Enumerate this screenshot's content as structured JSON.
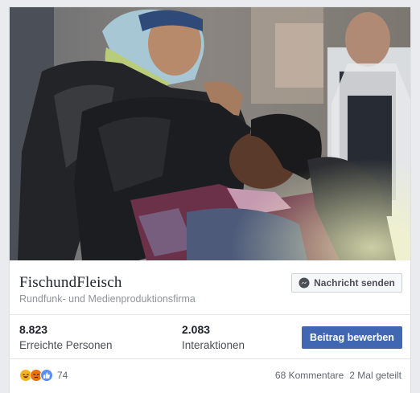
{
  "page": {
    "name": "FischundFleisch",
    "category": "Rundfunk- und Medienproduktionsfirma",
    "message_button_label": "Nachricht senden"
  },
  "stats": {
    "reach_value": "8.823",
    "reach_label": "Erreichte Personen",
    "interactions_value": "2.083",
    "interactions_label": "Interaktionen",
    "boost_button_label": "Beitrag bewerben"
  },
  "footer": {
    "reaction_icons": [
      "haha-icon",
      "angry-icon",
      "like-icon"
    ],
    "reaction_count": "74",
    "comments": "68 Kommentare",
    "shares": "2 Mal geteilt"
  },
  "colors": {
    "brand_blue": "#4267b2",
    "card_background": "#ffffff",
    "page_background": "#e9ebee",
    "secondary_text": "#90949c"
  }
}
